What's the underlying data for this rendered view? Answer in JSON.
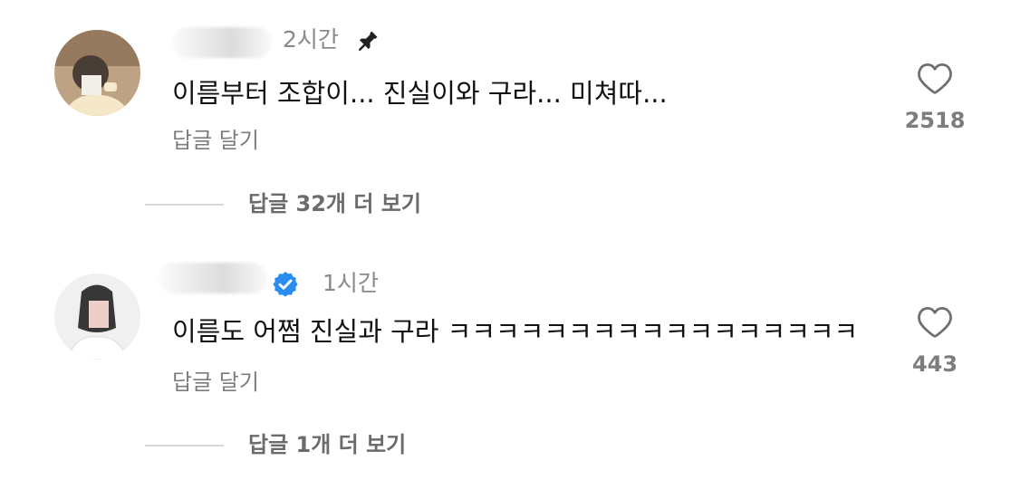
{
  "comments": [
    {
      "time": "2시간",
      "pinned": true,
      "verified": false,
      "text": "이름부터 조합이... 진실이와 구라... 미쳐따...",
      "reply_label": "답글 달기",
      "like_count": "2518",
      "view_replies": "답글 32개 더 보기"
    },
    {
      "time": "1시간",
      "pinned": false,
      "verified": true,
      "text": "이름도 어쩜 진실과 구라 ㅋㅋㅋㅋㅋㅋㅋㅋㅋㅋㅋㅋㅋㅋㅋㅋㅋ",
      "reply_label": "답글 달기",
      "like_count": "443",
      "view_replies": "답글 1개 더 보기"
    }
  ],
  "icons": {
    "heart": "heart-outline-icon",
    "pin": "pin-icon",
    "verified": "verified-badge-icon"
  },
  "colors": {
    "verified_blue": "#2b8cf0",
    "secondary_text": "#8a8a8a",
    "primary_text": "#111111"
  }
}
